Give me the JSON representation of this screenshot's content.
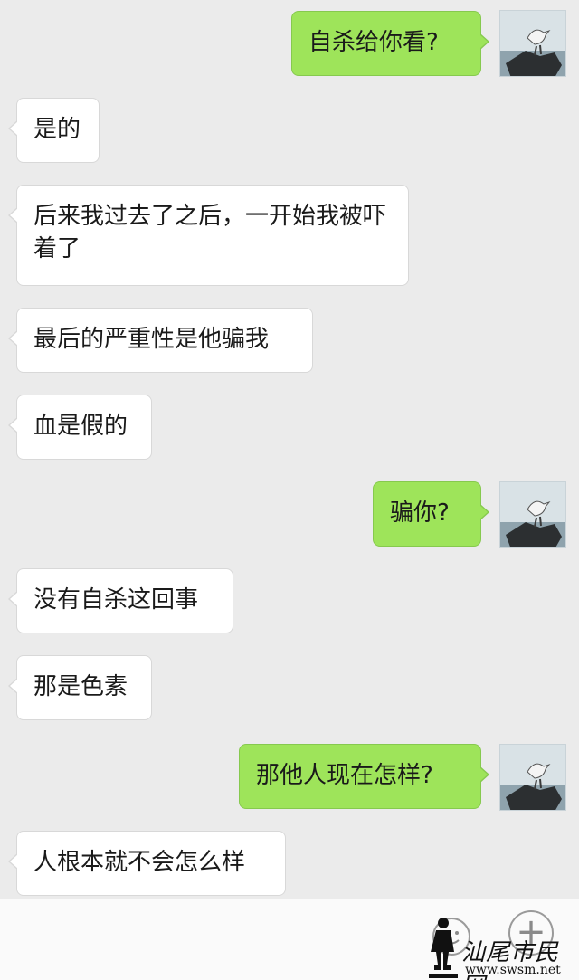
{
  "messages": [
    {
      "side": "right",
      "text": "自杀给你看?"
    },
    {
      "side": "left",
      "text": "是的"
    },
    {
      "side": "left",
      "text": "后来我过去了之后，一开始我被吓着了"
    },
    {
      "side": "left",
      "text": "最后的严重性是他骗我"
    },
    {
      "side": "left",
      "text": "血是假的"
    },
    {
      "side": "right",
      "text": "骗你?"
    },
    {
      "side": "left",
      "text": "没有自杀这回事"
    },
    {
      "side": "left",
      "text": "那是色素"
    },
    {
      "side": "right",
      "text": "那他人现在怎样?"
    },
    {
      "side": "left",
      "text": "人根本就不会怎么样"
    }
  ],
  "input_bar": {
    "emoji_icon": "emoji-icon",
    "plus_label": "+"
  },
  "watermark": {
    "title": "汕尾市民网",
    "url": "www.swsm.net"
  },
  "colors": {
    "background": "#ebebeb",
    "sent_bubble": "#9ee45a",
    "received_bubble": "#ffffff"
  }
}
